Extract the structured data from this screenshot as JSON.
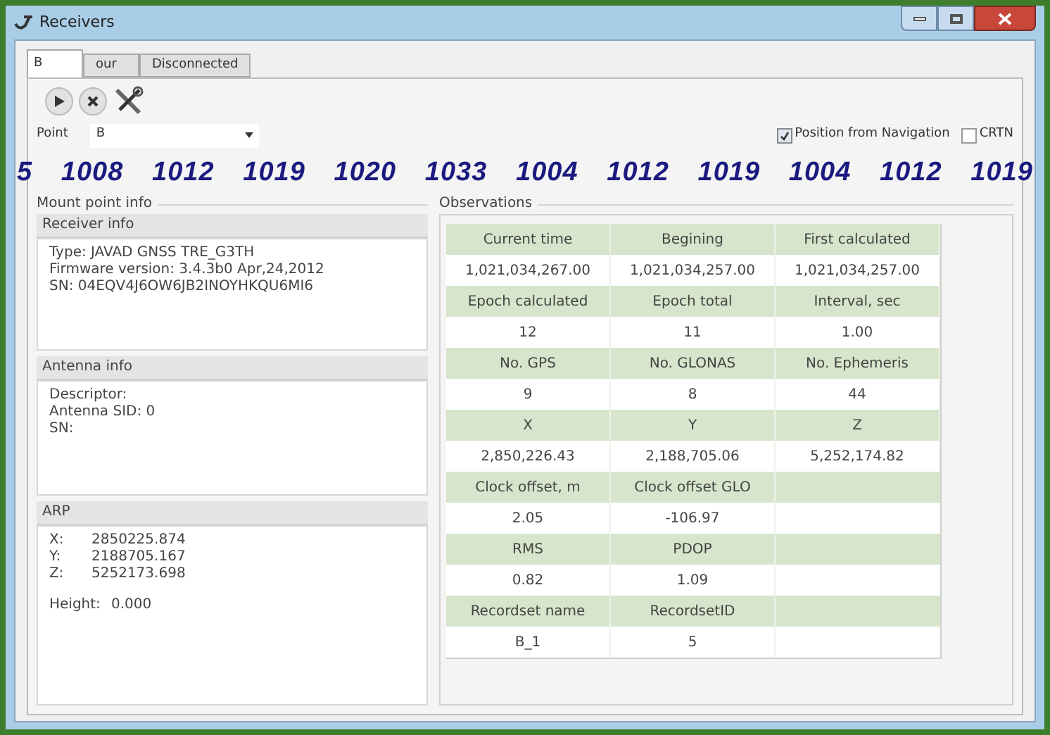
{
  "window": {
    "title": "Receivers"
  },
  "tabs": [
    {
      "label": "B",
      "selected": true
    },
    {
      "label": "our",
      "selected": false
    },
    {
      "label": "Disconnected",
      "selected": false
    }
  ],
  "point": {
    "label": "Point",
    "value": "B"
  },
  "options": [
    {
      "label": "Position from Navigation",
      "checked": true
    },
    {
      "label": "CRTN",
      "checked": false
    }
  ],
  "station_ids": [
    "5",
    "1008",
    "1012",
    "1019",
    "1020",
    "1033",
    "1004",
    "1012",
    "1019",
    "1004",
    "1012",
    "1019"
  ],
  "mount_point_info": {
    "title": "Mount point info",
    "receiver_info": {
      "title": "Receiver info",
      "lines": [
        "Type: JAVAD GNSS TRE_G3TH",
        "Firmware version: 3.4.3b0 Apr,24,2012",
        "SN: 04EQV4J6OW6JB2INOYHKQU6MI6"
      ]
    },
    "antenna_info": {
      "title": "Antenna info",
      "lines": [
        "Descriptor:",
        "Antenna SID: 0",
        "SN:"
      ]
    },
    "arp": {
      "title": "ARP",
      "coords": [
        {
          "label": "X:",
          "value": "2850225.874"
        },
        {
          "label": "Y:",
          "value": "2188705.167"
        },
        {
          "label": "Z:",
          "value": "5252173.698"
        }
      ],
      "height": {
        "label": "Height:",
        "value": "0.000"
      }
    }
  },
  "observations": {
    "title": "Observations",
    "rows": [
      {
        "kind": "header",
        "cells": [
          "Current time",
          "Begining",
          "First calculated"
        ]
      },
      {
        "kind": "value",
        "cells": [
          "1,021,034,267.00",
          "1,021,034,257.00",
          "1,021,034,257.00"
        ]
      },
      {
        "kind": "header",
        "cells": [
          "Epoch calculated",
          "Epoch total",
          "Interval, sec"
        ]
      },
      {
        "kind": "value",
        "cells": [
          "12",
          "11",
          "1.00"
        ]
      },
      {
        "kind": "header",
        "cells": [
          "No. GPS",
          "No. GLONAS",
          "No. Ephemeris"
        ]
      },
      {
        "kind": "value",
        "cells": [
          "9",
          "8",
          "44"
        ]
      },
      {
        "kind": "header",
        "cells": [
          "X",
          "Y",
          "Z"
        ]
      },
      {
        "kind": "value",
        "cells": [
          "2,850,226.43",
          "2,188,705.06",
          "5,252,174.82"
        ]
      },
      {
        "kind": "header",
        "cells": [
          "Clock offset, m",
          "Clock offset GLO"
        ]
      },
      {
        "kind": "value",
        "cells": [
          "2.05",
          "-106.97"
        ]
      },
      {
        "kind": "header",
        "cells": [
          "RMS",
          "PDOP"
        ]
      },
      {
        "kind": "value",
        "cells": [
          "0.82",
          "1.09"
        ]
      },
      {
        "kind": "header",
        "cells": [
          "Recordset name",
          "RecordsetID"
        ]
      },
      {
        "kind": "value",
        "cells": [
          "B_1",
          "5"
        ]
      }
    ]
  }
}
